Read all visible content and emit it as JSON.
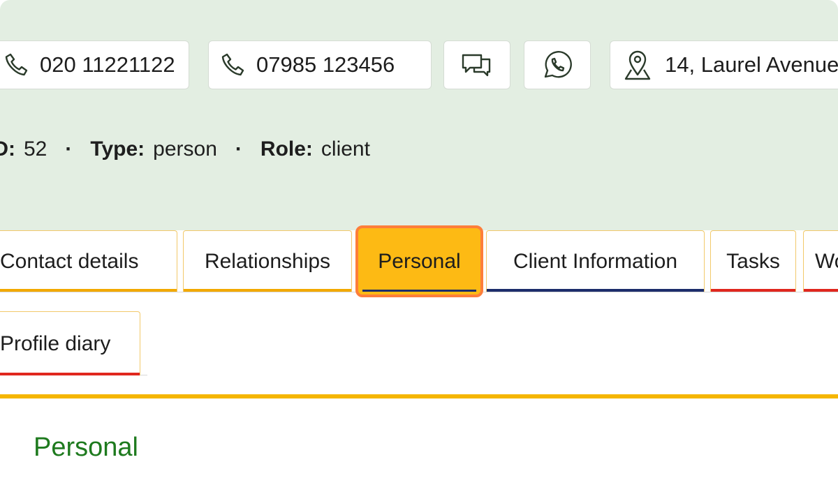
{
  "header": {
    "contacts": {
      "landline": "020 11221122",
      "mobile": "07985 123456",
      "address": "14, Laurel Avenue"
    },
    "meta": {
      "id_label": "ID:",
      "id_value": "52",
      "type_label": "Type:",
      "type_value": "person",
      "role_label": "Role:",
      "role_value": "client"
    }
  },
  "tabs": [
    {
      "label": "Contact details"
    },
    {
      "label": "Relationships"
    },
    {
      "label": "Personal"
    },
    {
      "label": "Client Information"
    },
    {
      "label": "Tasks"
    },
    {
      "label": "Workflow"
    }
  ],
  "subtabs": [
    {
      "label": "Profile diary"
    }
  ],
  "section": {
    "title": "Personal"
  },
  "colors": {
    "header_bg": "#e3eee2",
    "active_tab": "#fdba14",
    "highlight_border": "#fd7e3a",
    "accent_rule": "#f5b600",
    "underline_orange": "#f2a900",
    "underline_navy": "#1c2d6b",
    "underline_red": "#e0271e",
    "section_title": "#1e7a1e"
  },
  "icons": [
    "phone-icon",
    "chat-icon",
    "whatsapp-icon",
    "map-pin-icon"
  ]
}
